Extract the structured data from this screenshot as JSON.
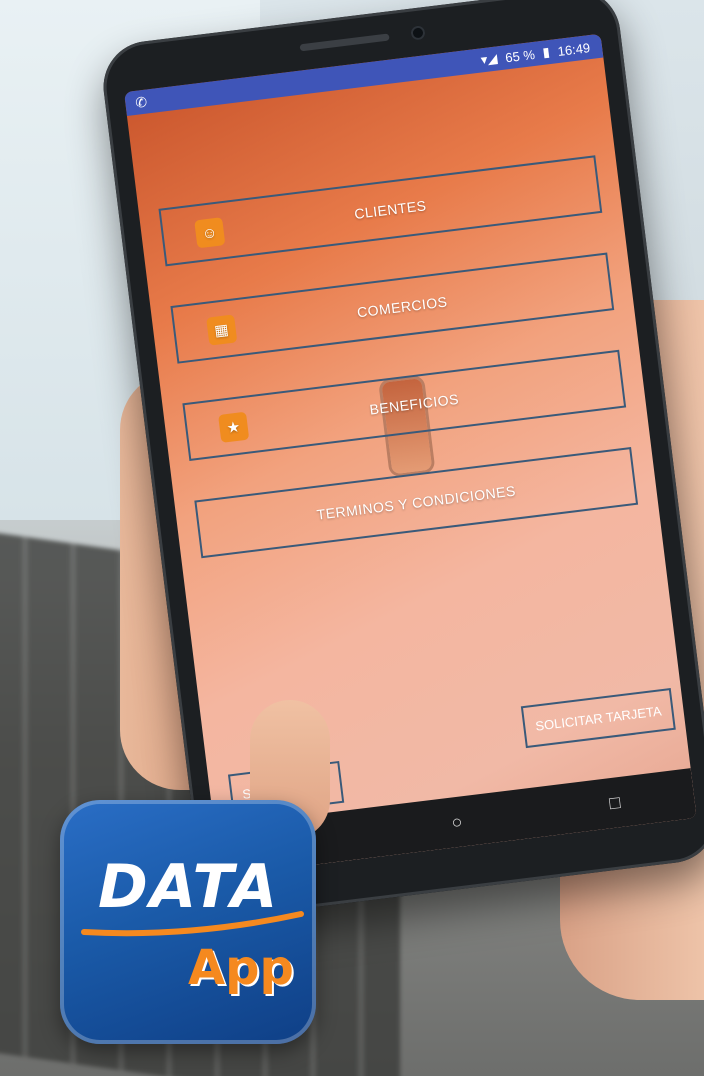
{
  "status_bar": {
    "app_indicator_icon": "whatsapp-icon",
    "signal_icons": "wifi-signal-icons",
    "battery_percent": "65 %",
    "time": "16:49"
  },
  "menu": {
    "items": [
      {
        "label": "CLIENTES",
        "icon": "clients-icon"
      },
      {
        "label": "COMERCIOS",
        "icon": "store-icon"
      },
      {
        "label": "BENEFICIOS",
        "icon": "benefits-icon"
      },
      {
        "label": "TERMINOS Y CONDICIONES",
        "icon": ""
      }
    ]
  },
  "bottom_buttons": {
    "branches": "SUCURSALES",
    "request_card": "SOLICITAR TARJETA"
  },
  "nav": {
    "back": "◁",
    "home": "○",
    "recents": "□"
  },
  "logo": {
    "line1": "DATA",
    "line2": "App",
    "colors": {
      "blue": "#1a5aa8",
      "orange": "#f5891f"
    }
  }
}
